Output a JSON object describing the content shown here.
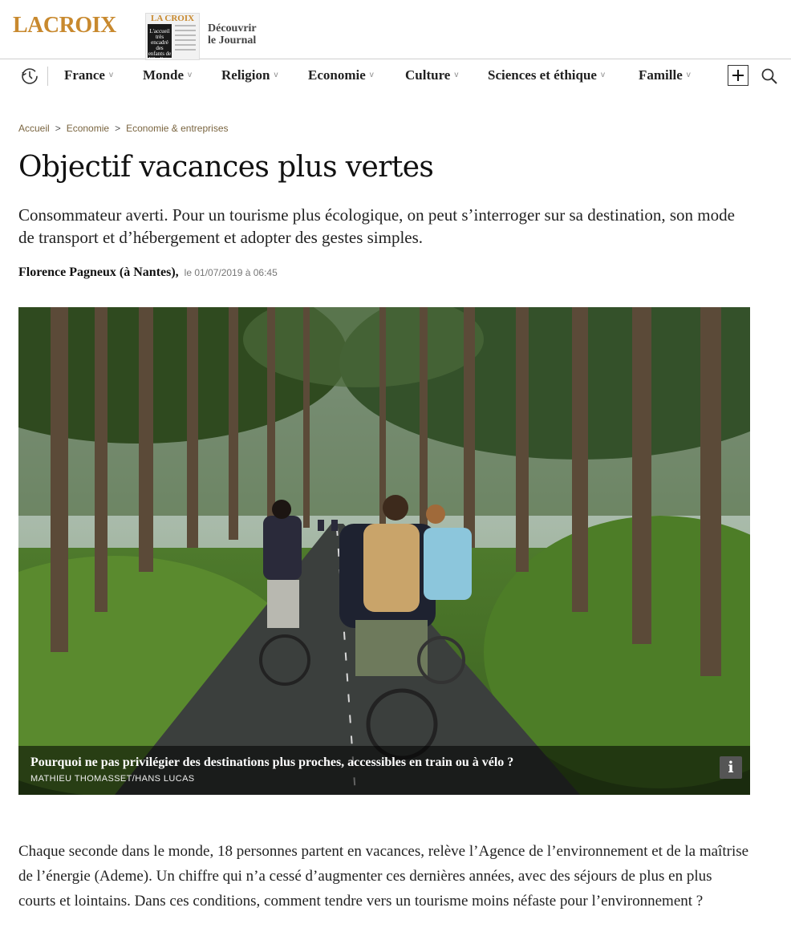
{
  "header": {
    "logo_text": "LACROIX",
    "journal_masthead": "LA CROIX",
    "journal_cover_text": "L'accueil très encadré des enfants de djihadistes",
    "discover_line1": "Découvrir",
    "discover_line2": "le Journal"
  },
  "nav": {
    "history_icon": "history-clock-icon",
    "items": [
      {
        "label": "France",
        "chevron": "v"
      },
      {
        "label": "Monde",
        "chevron": "v"
      },
      {
        "label": "Religion",
        "chevron": "v"
      },
      {
        "label": "Economie",
        "chevron": "v"
      },
      {
        "label": "Culture",
        "chevron": "v"
      },
      {
        "label": "Sciences et éthique",
        "chevron": "v"
      },
      {
        "label": "Famille",
        "chevron": "v"
      }
    ],
    "plus_icon": "plus-icon",
    "search_icon": "search-icon"
  },
  "breadcrumb": {
    "items": [
      "Accueil",
      "Economie",
      "Economie & entreprises"
    ],
    "separator": ">"
  },
  "article": {
    "title": "Objectif vacances plus vertes",
    "standfirst": "Consommateur averti. Pour un tourisme plus écologique, on peut s’interroger sur sa destination, son mode de transport et d’hébergement et adopter des gestes simples.",
    "author": "Florence Pagneux (à Nantes),",
    "date": "le 01/07/2019 à 06:45",
    "image": {
      "caption": "Pourquoi ne pas privilégier des destinations plus proches, accessibles en train ou à vélo ?",
      "credit": "MATHIEU THOMASSET/HANS LUCAS",
      "info_label": "i"
    },
    "body": "Chaque seconde dans le monde, 18 personnes partent en vacances, relève l’Agence de l’environnement et de la maîtrise de l’énergie (Ademe). Un chiffre qui n’a cessé d’augmenter ces dernières années, avec des séjours de plus en plus courts et lointains. Dans ces conditions, comment tendre vers un tourisme moins néfaste pour l’environnement ?"
  },
  "colors": {
    "brand": "#c8892e",
    "breadcrumb": "#7a6540"
  }
}
